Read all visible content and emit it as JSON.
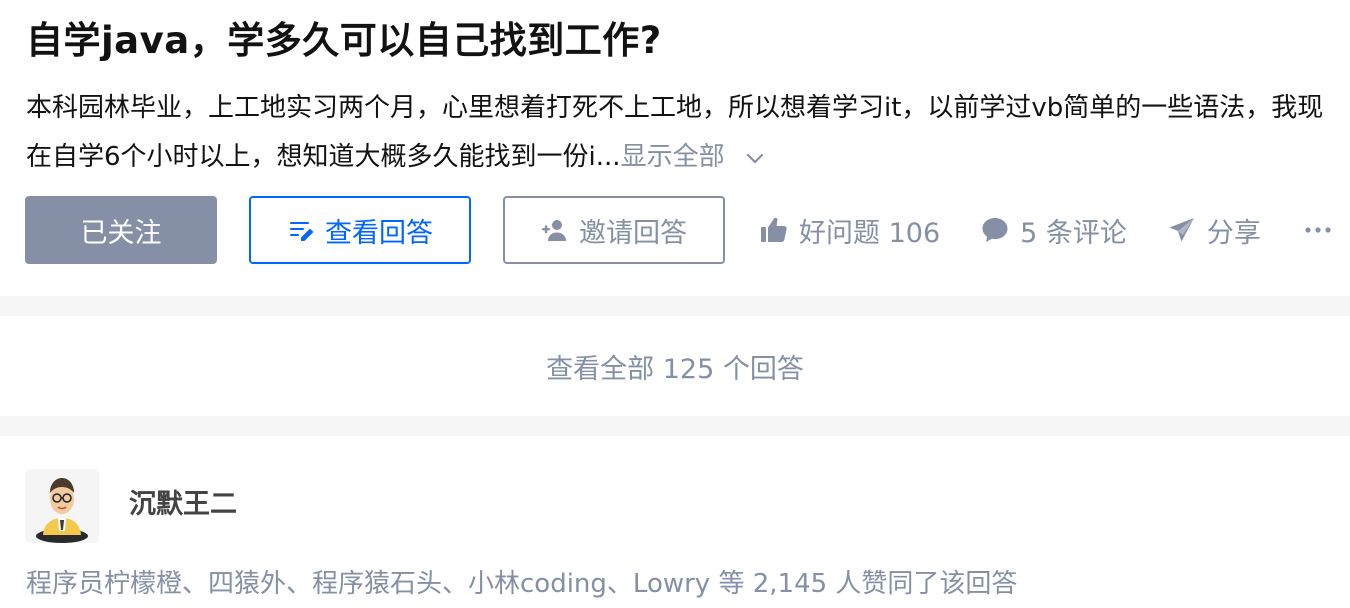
{
  "question": {
    "title": "自学java，学多久可以自己找到工作?",
    "detail_text": "本科园林毕业，上工地实习两个月，心里想着打死不上工地，所以想着学习it，以前学过vb简单的一些语法，我现在自学6个小时以上，想知道大概多久能找到一份i...",
    "show_all_label": "显示全部",
    "show_all_icon": "chevron-down-icon"
  },
  "actions": {
    "followed_label": "已关注",
    "view_answers_label": "查看回答",
    "invite_label": "邀请回答",
    "good_question_label": "好问题 106",
    "comments_label": "5 条评论",
    "share_label": "分享",
    "more_icon": "more-horizontal-icon"
  },
  "view_all": {
    "label": "查看全部 125 个回答"
  },
  "answer": {
    "author_name": "沉默王二",
    "voters_text": "程序员柠檬橙、四猿外、程序猿石头、小林coding、Lowry 等 2,145 人赞同了该回答"
  },
  "colors": {
    "primary_blue": "#0066ff",
    "muted_gray": "#8590a6",
    "text": "#121212",
    "background": "#f6f6f6"
  }
}
